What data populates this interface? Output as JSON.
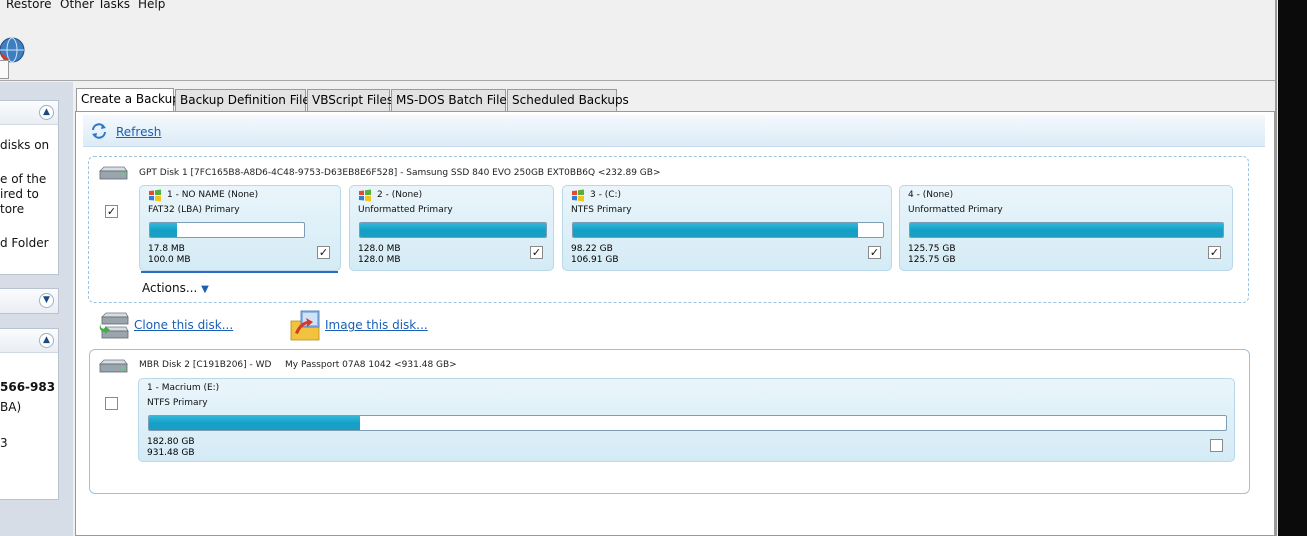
{
  "menu": {
    "items": [
      "Restore",
      "Other Tasks",
      "Help"
    ]
  },
  "left_panel": {
    "box1_lines": [
      "disks on",
      "e of the",
      "ired to",
      "tore",
      "d Folder"
    ],
    "box3_lines": [
      "566-983",
      "BA)",
      "3"
    ]
  },
  "tabs": [
    {
      "label": "Create a Backup",
      "active": true
    },
    {
      "label": "Backup Definition Files",
      "active": false
    },
    {
      "label": "VBScript Files",
      "active": false
    },
    {
      "label": "MS-DOS Batch Files",
      "active": false
    },
    {
      "label": "Scheduled Backups",
      "active": false
    }
  ],
  "refresh_label": "Refresh",
  "disk1": {
    "title": "GPT Disk 1 [7FC165B8-A8D6-4C48-9753-D63EB8E6F528] - Samsung SSD 840 EVO 250GB EXT0BB6Q  <232.89 GB>",
    "checked": true,
    "partitions": [
      {
        "name": "1 - NO NAME (None)",
        "fs": "FAT32 (LBA) Primary",
        "used": "17.8 MB",
        "total": "100.0 MB",
        "fill": 0.178,
        "checked": true
      },
      {
        "name": "2 -  (None)",
        "fs": "Unformatted Primary",
        "used": "128.0 MB",
        "total": "128.0 MB",
        "fill": 1.0,
        "checked": true
      },
      {
        "name": "3 -  (C:)",
        "fs": "NTFS Primary",
        "used": "98.22 GB",
        "total": "106.91 GB",
        "fill": 0.919,
        "checked": true
      },
      {
        "name": "4 -  (None)",
        "fs": "Unformatted Primary",
        "used": "125.75 GB",
        "total": "125.75 GB",
        "fill": 1.0,
        "checked": true
      }
    ],
    "actions_label": "Actions..."
  },
  "clone_link": "Clone this disk...",
  "image_link": "Image this disk...",
  "disk2": {
    "title": "MBR Disk 2 [C191B206] - WD",
    "model": "My Passport 07A8 1042  <931.48 GB>",
    "checked": false,
    "partitions": [
      {
        "name": "1 - Macrium (E:)",
        "fs": "NTFS Primary",
        "used": "182.80 GB",
        "total": "931.48 GB",
        "fill": 0.196,
        "checked": false
      }
    ]
  },
  "colors": {
    "accent": "#1a5fb4",
    "bar_fill": "#1aa2c9",
    "partition_bg": "#d4ebf5"
  },
  "icons": [
    "app-globe-icon",
    "refresh-icon",
    "disk-icon",
    "windows-flag-icon",
    "clone-disk-icon",
    "image-disk-icon",
    "chevron-up-icon",
    "chevron-down-icon"
  ]
}
